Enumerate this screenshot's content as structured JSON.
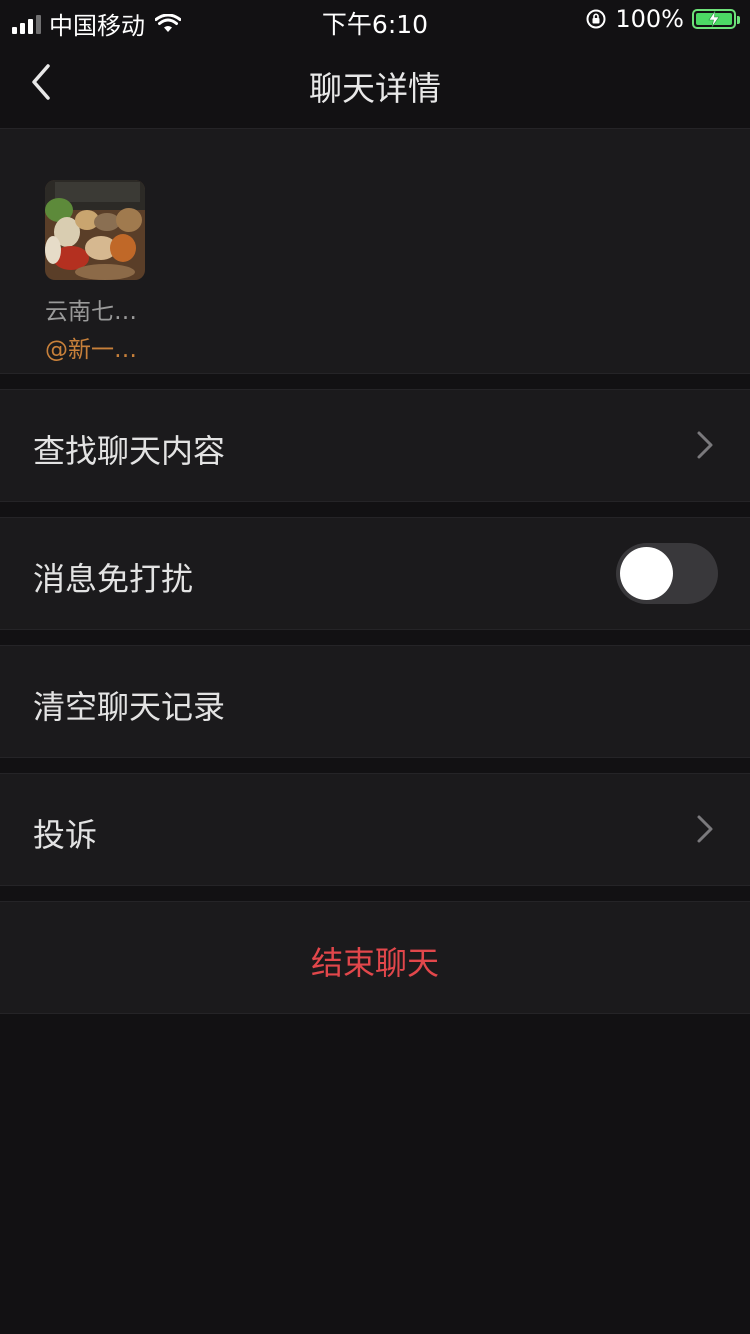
{
  "status_bar": {
    "carrier": "中国移动",
    "time": "下午6:10",
    "battery": "100%",
    "icons": [
      "signal-icon",
      "wifi-icon",
      "orientation-lock-icon",
      "battery-charging-icon"
    ]
  },
  "nav": {
    "title": "聊天详情",
    "back_icon": "back-chevron-icon"
  },
  "members": [
    {
      "name": "云南七…",
      "sub": "@新一…"
    }
  ],
  "settings": {
    "search_label": "查找聊天内容",
    "mute_label": "消息免打扰",
    "mute_on": false,
    "clear_label": "清空聊天记录",
    "report_label": "投诉",
    "end_label": "结束聊天"
  },
  "colors": {
    "background": "#121113",
    "row": "#1b1a1c",
    "danger": "#e2474b",
    "mention": "#c8803a",
    "battery": "#4cd964"
  }
}
